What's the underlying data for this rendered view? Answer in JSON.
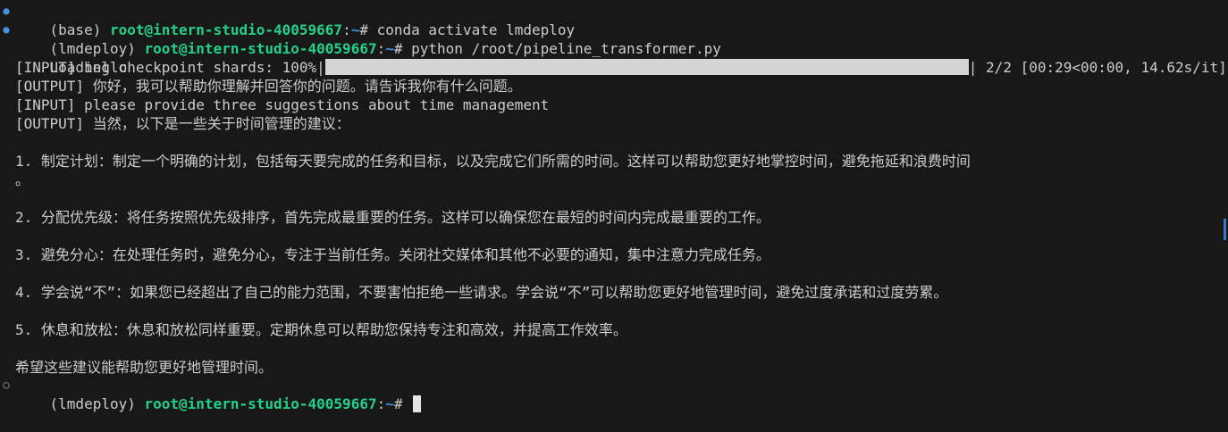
{
  "colors": {
    "background": "#181818",
    "text": "#cccccc",
    "prompt_user": "#23d18b",
    "prompt_path": "#3b8eea",
    "progress_fill": "#d4d4d4",
    "scroll_accent": "#3c78c8"
  },
  "prompts": [
    {
      "env": "(base) ",
      "user_host": "root@intern-studio-40059667",
      "sep": ":",
      "path": "~",
      "symbol": "# ",
      "command": "conda activate lmdeploy"
    },
    {
      "env": "(lmdeploy) ",
      "user_host": "root@intern-studio-40059667",
      "sep": ":",
      "path": "~",
      "symbol": "# ",
      "command": "python /root/pipeline_transformer.py"
    },
    {
      "env": "(lmdeploy) ",
      "user_host": "root@intern-studio-40059667",
      "sep": ":",
      "path": "~",
      "symbol": "# ",
      "command": ""
    }
  ],
  "progress": {
    "prefix": "Loading checkpoint shards: 100%|",
    "suffix": "| 2/2 [00:29<00:00, 14.62s/it]",
    "fraction": 1.0
  },
  "output_lines": [
    "[INPUT] hello",
    "[OUTPUT] 你好，我可以帮助你理解并回答你的问题。请告诉我你有什么问题。",
    "[INPUT] please provide three suggestions about time management",
    "[OUTPUT] 当然，以下是一些关于时间管理的建议：",
    "",
    "1. 制定计划：制定一个明确的计划，包括每天要完成的任务和目标，以及完成它们所需的时间。这样可以帮助您更好地掌控时间，避免拖延和浪费时间",
    "。",
    "",
    "2. 分配优先级：将任务按照优先级排序，首先完成最重要的任务。这样可以确保您在最短的时间内完成最重要的工作。",
    "",
    "3. 避免分心：在处理任务时，避免分心，专注于当前任务。关闭社交媒体和其他不必要的通知，集中注意力完成任务。",
    "",
    "4. 学会说“不”：如果您已经超出了自己的能力范围，不要害怕拒绝一些请求。学会说“不”可以帮助您更好地管理时间，避免过度承诺和过度劳累。",
    "",
    "5. 休息和放松：休息和放松同样重要。定期休息可以帮助您保持专注和高效，并提高工作效率。",
    "",
    "希望这些建议能帮助您更好地管理时间。"
  ],
  "markers": {
    "first": "●",
    "second": "●",
    "last": "○"
  }
}
